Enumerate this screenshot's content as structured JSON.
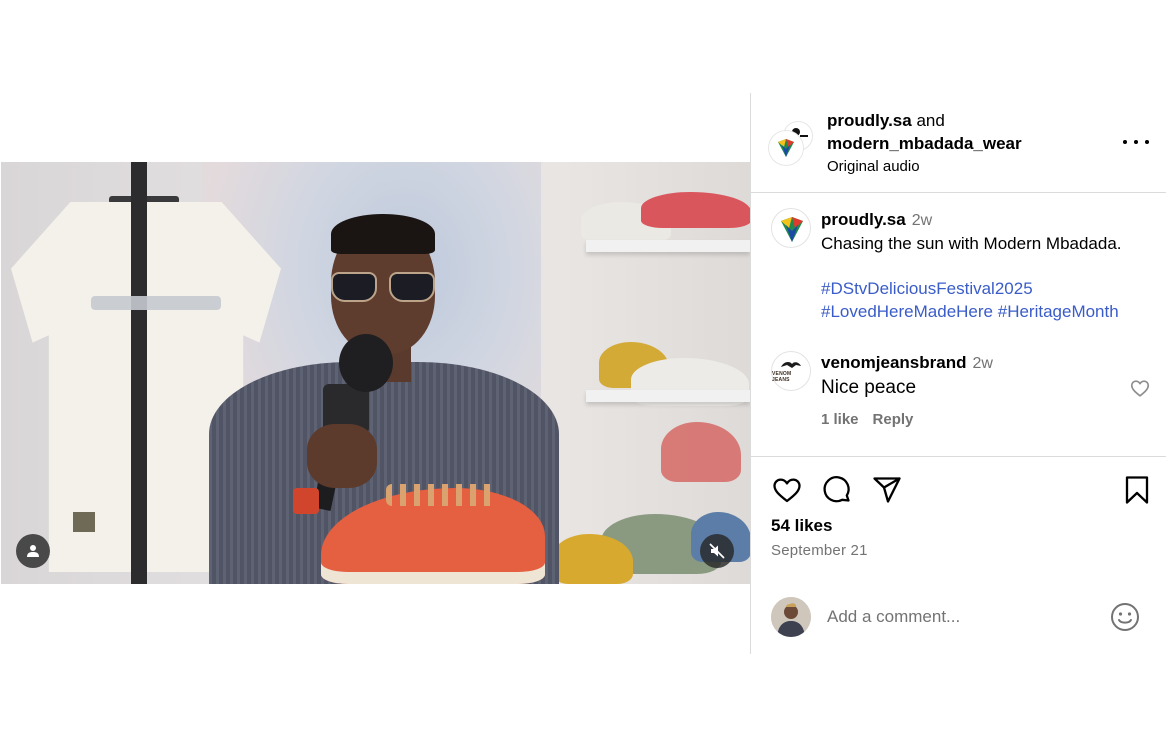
{
  "media": {
    "user_tag_icon": "person-icon",
    "mute_icon": "speaker-muted-icon"
  },
  "header": {
    "author1": "proudly.sa",
    "joiner": "and",
    "author2": "modern_mbadada_wear",
    "audio": "Original audio",
    "more_icon": "more-horizontal-icon"
  },
  "caption": {
    "username": "proudly.sa",
    "time": "2w",
    "text": "Chasing the sun with Modern Mbadada.",
    "hashtags": [
      "#DStvDeliciousFestival2025",
      "#LovedHereMadeHere",
      "#HeritageMonth"
    ]
  },
  "comment": {
    "username": "venomjeansbrand",
    "time": "2w",
    "text": "Nice peace",
    "likes": "1 like",
    "reply": "Reply",
    "avatar_text": "VENOM JEANS"
  },
  "actions": {
    "like_icon": "heart-icon",
    "comment_icon": "comment-bubble-icon",
    "share_icon": "paper-plane-icon",
    "save_icon": "bookmark-icon",
    "likes": "54 likes",
    "date": "September 21"
  },
  "composer": {
    "placeholder": "Add a comment...",
    "emoji_icon": "smiley-icon"
  },
  "colors": {
    "hashtag": "#3a5cc9",
    "muted_text": "#737373",
    "divider": "#dbdbdb"
  }
}
